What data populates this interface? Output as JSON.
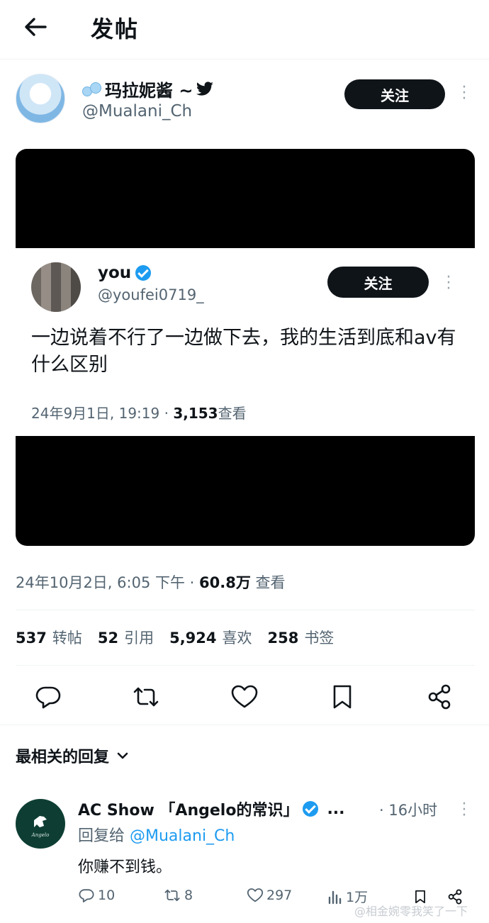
{
  "header": {
    "title": "发帖"
  },
  "author": {
    "name": "玛拉妮酱 ~",
    "handle": "@Mualani_Ch",
    "follow_label": "关注"
  },
  "embedded": {
    "name": "you",
    "handle": "@youfei0719_",
    "follow_label": "关注",
    "text": "一边说着不行了一边做下去，我的生活到底和av有什么区别",
    "date": "24年9月1日, 19:19 · ",
    "views_count": "3,153",
    "views_label": "查看"
  },
  "post": {
    "date": "24年10月2日, 6:05 下午 · ",
    "views_count": "60.8万",
    "views_label": " 查看"
  },
  "stats": {
    "reposts_count": "537",
    "reposts_label": "转帖",
    "quotes_count": "52",
    "quotes_label": "引用",
    "likes_count": "5,924",
    "likes_label": "喜欢",
    "bookmarks_count": "258",
    "bookmarks_label": "书签"
  },
  "replies": {
    "sort_label": "最相关的回复"
  },
  "reply": {
    "name": "AC Show 「Angelo的常识」",
    "ellipsis": "...",
    "time": "· 16小时",
    "reply_to_prefix": "回复给 ",
    "reply_to_handle": "@Mualani_Ch",
    "text": "你赚不到钱。",
    "avatar_text": "Angelo",
    "replies_count": "10",
    "reposts_count": "8",
    "likes_count": "297",
    "views_count": "1万"
  },
  "watermark": "@相金婉零我笑了一下",
  "colors": {
    "accent": "#1d9bf0",
    "text": "#0f1419",
    "muted": "#536471",
    "button": "#0f1419"
  }
}
